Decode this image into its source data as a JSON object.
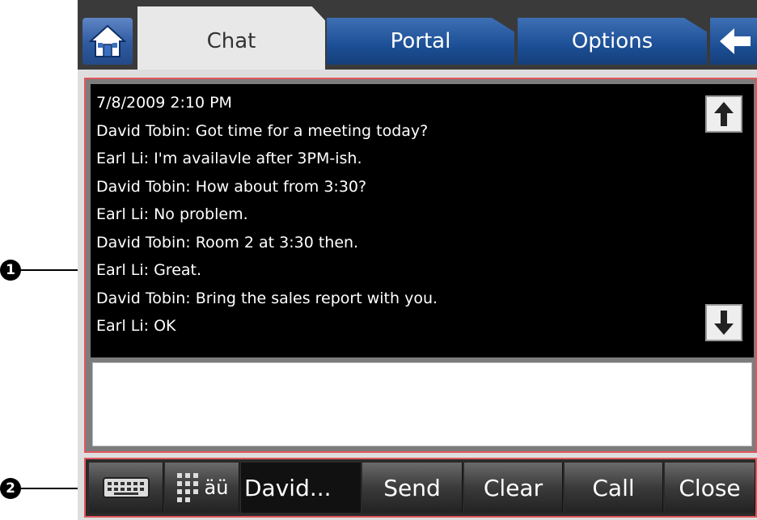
{
  "callouts": [
    "1",
    "2"
  ],
  "tabs": {
    "home_icon": "home-icon",
    "items": [
      {
        "label": "Chat",
        "active": true
      },
      {
        "label": "Portal",
        "active": false
      },
      {
        "label": "Options",
        "active": false
      }
    ],
    "back_icon": "back-arrow-icon"
  },
  "chat": {
    "timestamp": "7/8/2009 2:10 PM",
    "messages": [
      "David Tobin: Got time for a meeting today?",
      "Earl Li: I'm availavle after 3PM-ish.",
      "David Tobin: How about from 3:30?",
      "Earl Li: No problem.",
      "David Tobin: Room 2 at 3:30 then.",
      "Earl Li: Great.",
      "David Tobin: Bring the sales report with you.",
      "Earl Li: OK"
    ],
    "input_value": ""
  },
  "toolbar": {
    "keyboard_icon": "keyboard-icon",
    "keypad_label": "äü",
    "recipient": "David...",
    "send": "Send",
    "clear": "Clear",
    "call": "Call",
    "close": "Close"
  },
  "colors": {
    "tab_blue": "#1c4f96",
    "highlight_red": "#e0565c",
    "log_bg": "#000000"
  }
}
